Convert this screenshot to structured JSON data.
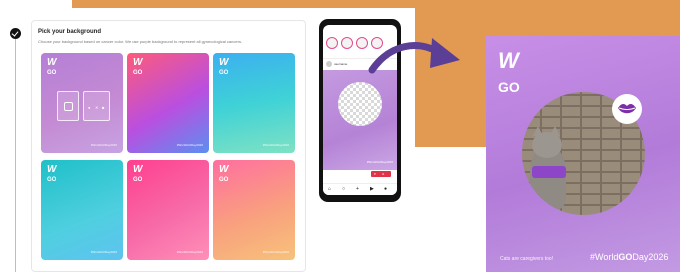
{
  "colors": {
    "orange_block": "#e29a52",
    "poster_purple": "#b27bd9",
    "arrow_purple": "#5b3f97",
    "accent_pink": "#e44a8c"
  },
  "picker": {
    "title": "Pick your background",
    "subtitle": "Choose your background based on cancer color. We use purple background to represent all gynecological cancers.",
    "tiles": [
      {
        "logo_go": "GO",
        "tag": "#WorldGODay2026"
      },
      {
        "logo_go": "GO",
        "tag": "#WorldGODay2026"
      },
      {
        "logo_go": "GO",
        "tag": "#WorldGODay2026"
      },
      {
        "logo_go": "GO",
        "tag": "#WorldGODay2026"
      },
      {
        "logo_go": "GO",
        "tag": "#WorldGODay2026"
      },
      {
        "logo_go": "GO",
        "tag": "#WorldGODay2026"
      }
    ],
    "social_icons": [
      "facebook-icon",
      "x-icon",
      "linkedin-icon"
    ]
  },
  "phone": {
    "profile_name": "username",
    "post_tag": "#WorldGODay2026",
    "nav_icons": [
      "home-icon",
      "search-icon",
      "add-icon",
      "reels-icon",
      "profile-icon"
    ]
  },
  "poster": {
    "logo_go": "GO",
    "caption": "Cats are caregivers too!",
    "hashtag_pre": "#World",
    "hashtag_bold": "GO",
    "hashtag_post": "Day2026"
  }
}
